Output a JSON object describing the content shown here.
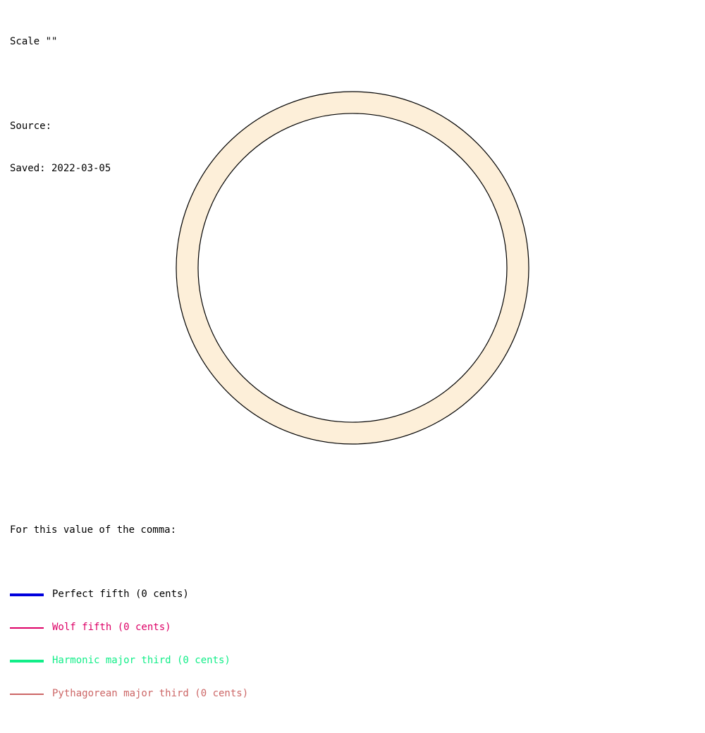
{
  "header": {
    "scale_title": "Scale \"\"",
    "source": "Source:",
    "saved": "Saved: 2022-03-05"
  },
  "diagram": {
    "ring_fill_color": "#fdefd9",
    "ring_stroke_color": "#000000"
  },
  "legend": {
    "title": "For this value of the comma:",
    "items": [
      {
        "label": "Perfect fifth (0 cents)",
        "color": "#0000dd",
        "thickness": 4
      },
      {
        "label": "Wolf fifth (0 cents)",
        "color": "#dd0066",
        "thickness": 2
      },
      {
        "label": "Harmonic major third (0 cents)",
        "color": "#11ee88",
        "thickness": 4
      },
      {
        "label": "Pythagorean major third (0 cents)",
        "color": "#cc6666",
        "thickness": 2
      }
    ]
  }
}
